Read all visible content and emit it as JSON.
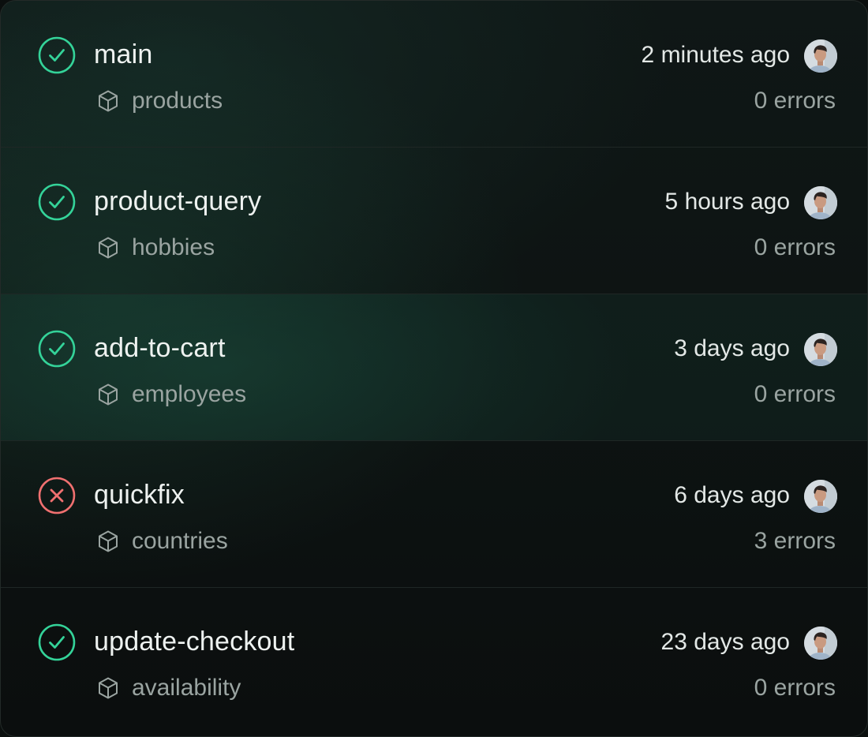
{
  "colors": {
    "success": "#34d399",
    "error": "#f07070",
    "background": "#0d1312"
  },
  "deployments": [
    {
      "branch": "main",
      "repo": "products",
      "time": "2 minutes ago",
      "errors": "0 errors",
      "status": "success",
      "status_icon": "check-circle-icon"
    },
    {
      "branch": "product-query",
      "repo": "hobbies",
      "time": "5 hours ago",
      "errors": "0 errors",
      "status": "success",
      "status_icon": "check-circle-icon"
    },
    {
      "branch": "add-to-cart",
      "repo": "employees",
      "time": "3 days ago",
      "errors": "0 errors",
      "status": "success",
      "status_icon": "check-circle-icon"
    },
    {
      "branch": "quickfix",
      "repo": "countries",
      "time": "6 days ago",
      "errors": "3 errors",
      "status": "error",
      "status_icon": "x-circle-icon"
    },
    {
      "branch": "update-checkout",
      "repo": "availability",
      "time": "23 days ago",
      "errors": "0 errors",
      "status": "success",
      "status_icon": "check-circle-icon"
    }
  ]
}
